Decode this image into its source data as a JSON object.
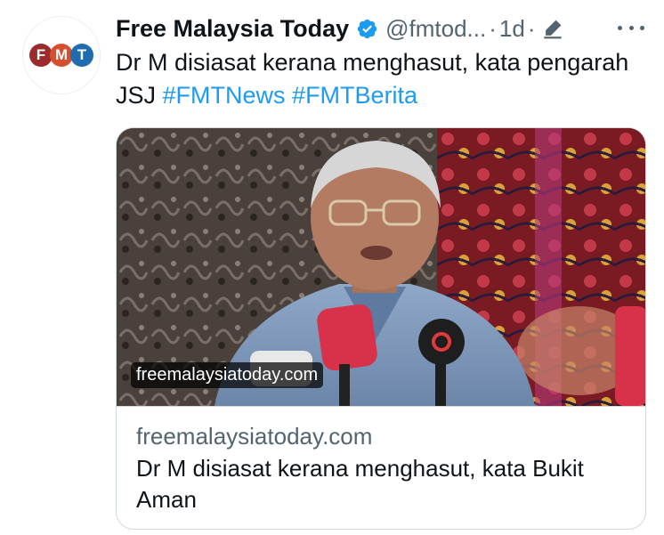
{
  "author": {
    "display_name": "Free Malaysia Today",
    "handle": "@fmtod...",
    "time": "1d",
    "avatar_letters": [
      "F",
      "M",
      "T"
    ],
    "avatar_colors": [
      "#9b2c2c",
      "#d6502f",
      "#1f6cb0"
    ]
  },
  "tweet": {
    "text": "Dr M disiasat kerana menghasut, kata pengarah JSJ ",
    "hashtags": [
      "#FMTNews",
      "#FMTBerita"
    ]
  },
  "card": {
    "image_overlay_domain": "freemalaysiatoday.com",
    "domain": "freemalaysiatoday.com",
    "title": "Dr M disiasat kerana menghasut, kata Bukit Aman"
  },
  "colors": {
    "accent": "#1d9bf0",
    "secondary_text": "#536471",
    "primary_text": "#0f1419",
    "border": "#cfd9de"
  },
  "icons": {
    "verified": "verified-badge-icon",
    "edited": "pencil-edit-icon",
    "more": "more-dots-icon"
  }
}
